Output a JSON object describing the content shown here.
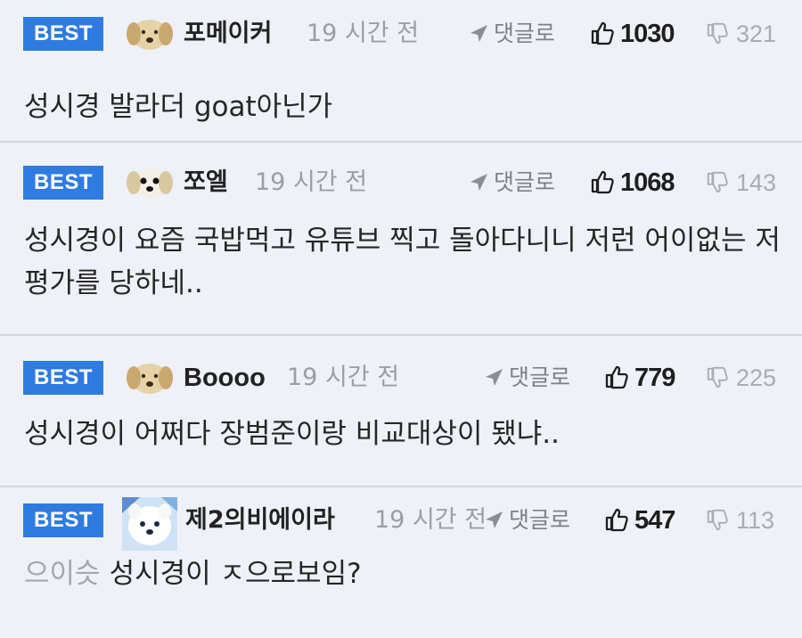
{
  "colors": {
    "background": "#eef1f8",
    "best_badge": "#2f7be0",
    "divider": "#d4d7de",
    "muted_text": "#9a9ea6"
  },
  "comments": [
    {
      "badge": "BEST",
      "avatar_icon": "dog-avatar-icon",
      "nickname": "포메이커",
      "time": "19 시간 전",
      "reply_label": "댓글로",
      "likes": "1030",
      "dislikes": "321",
      "prefix": "",
      "text": "성시경 발라더 goat아닌가"
    },
    {
      "badge": "BEST",
      "avatar_icon": "dog-avatar-icon",
      "nickname": "쪼엘",
      "time": "19 시간 전",
      "reply_label": "댓글로",
      "likes": "1068",
      "dislikes": "143",
      "prefix": "",
      "text": "성시경이 요즘 국밥먹고 유튜브 찍고 돌아다니니 저런 어이없는 저평가를 당하네.."
    },
    {
      "badge": "BEST",
      "avatar_icon": "dog-avatar-icon",
      "nickname": "Boooo",
      "time": "19 시간 전",
      "reply_label": "댓글로",
      "likes": "779",
      "dislikes": "225",
      "prefix": "",
      "text": "성시경이 어쩌다 장범준이랑 비교대상이 됐냐.."
    },
    {
      "badge": "BEST",
      "avatar_icon": "white-dog-avatar-icon",
      "nickname": "제2의비에이라",
      "time": "19 시간 전",
      "reply_label": "댓글로",
      "likes": "547",
      "dislikes": "113",
      "prefix": "으이슷",
      "text": "성시경이 ㅈ으로보임?"
    }
  ]
}
